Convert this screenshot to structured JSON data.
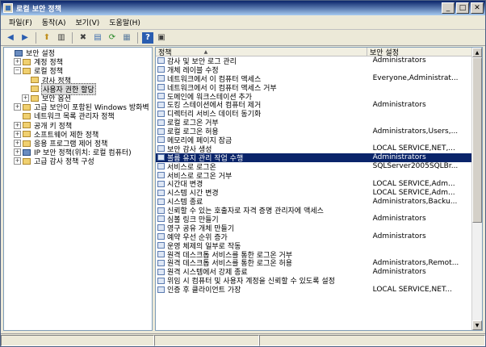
{
  "window": {
    "title": "로컬 보안 정책",
    "min_glyph": "_",
    "max_glyph": "□",
    "close_glyph": "✕"
  },
  "menu": [
    {
      "label": "파일(F)"
    },
    {
      "label": "동작(A)"
    },
    {
      "label": "보기(V)"
    },
    {
      "label": "도움말(H)"
    }
  ],
  "toolbar": [
    {
      "name": "back-icon",
      "glyph": "◀",
      "color": "#2a5db0"
    },
    {
      "name": "forward-icon",
      "glyph": "▶",
      "color": "#2a5db0"
    },
    {
      "sep": true
    },
    {
      "name": "up-folder-icon",
      "glyph": "⬆",
      "color": "#c09020"
    },
    {
      "name": "show-hide-tree-icon",
      "glyph": "▥",
      "color": "#404040"
    },
    {
      "sep": true
    },
    {
      "name": "delete-icon",
      "glyph": "✖",
      "color": "#404040"
    },
    {
      "name": "properties-icon",
      "glyph": "▤",
      "color": "#4070b0"
    },
    {
      "name": "refresh-icon",
      "glyph": "⟳",
      "color": "#2a8a2a"
    },
    {
      "name": "export-list-icon",
      "glyph": "▦",
      "color": "#6080a0"
    },
    {
      "sep": true
    },
    {
      "name": "help-icon",
      "glyph": "?",
      "color": "#ffffff",
      "bg": "#2a5db0"
    },
    {
      "name": "console-icon",
      "glyph": "▣",
      "color": "#404040"
    }
  ],
  "tree": [
    {
      "label": "보안 설정",
      "level": 0,
      "expander": "",
      "icon": "computer"
    },
    {
      "label": "계정 정책",
      "level": 1,
      "expander": "+",
      "icon": "folder"
    },
    {
      "label": "로컬 정책",
      "level": 1,
      "expander": "−",
      "icon": "folder"
    },
    {
      "label": "감사 정책",
      "level": 2,
      "expander": "",
      "icon": "folder"
    },
    {
      "label": "사용자 권한 할당",
      "level": 2,
      "expander": "",
      "icon": "folder",
      "selected": true
    },
    {
      "label": "보안 옵션",
      "level": 2,
      "expander": "+",
      "icon": "folder"
    },
    {
      "label": "고급 보안이 포함된 Windows 방화벽",
      "level": 1,
      "expander": "+",
      "icon": "folder"
    },
    {
      "label": "네트워크 목록 관리자 정책",
      "level": 1,
      "expander": "",
      "icon": "folder"
    },
    {
      "label": "공개 키 정책",
      "level": 1,
      "expander": "+",
      "icon": "folder"
    },
    {
      "label": "소프트웨어 제한 정책",
      "level": 1,
      "expander": "+",
      "icon": "folder"
    },
    {
      "label": "응용 프로그램 제어 정책",
      "level": 1,
      "expander": "+",
      "icon": "folder"
    },
    {
      "label": "IP 보안 정책(위치: 로컬 컴퓨터)",
      "level": 1,
      "expander": "+",
      "icon": "computer"
    },
    {
      "label": "고급 감사 정책 구성",
      "level": 1,
      "expander": "+",
      "icon": "folder"
    }
  ],
  "columns": {
    "policy": "정책",
    "setting": "보안 설정",
    "sort_glyph": "▲"
  },
  "policies": [
    {
      "name": "감사 및 보안 로그 관리",
      "setting": "Administrators"
    },
    {
      "name": "개체 레이블 수정",
      "setting": ""
    },
    {
      "name": "네트워크에서 이 컴퓨터 액세스",
      "setting": "Everyone,Administrat..."
    },
    {
      "name": "네트워크에서 이 컴퓨터 액세스 거부",
      "setting": ""
    },
    {
      "name": "도메인에 워크스테이션 추가",
      "setting": ""
    },
    {
      "name": "도킹 스테이션에서 컴퓨터 제거",
      "setting": "Administrators"
    },
    {
      "name": "디렉터리 서비스 데이터 동기화",
      "setting": ""
    },
    {
      "name": "로컬 로그온 거부",
      "setting": ""
    },
    {
      "name": "로컬 로그온 허용",
      "setting": "Administrators,Users,..."
    },
    {
      "name": "메모리에 페이지 잠금",
      "setting": ""
    },
    {
      "name": "보안 감사 생성",
      "setting": "LOCAL SERVICE,NET,..."
    },
    {
      "name": "볼륨 유지 관리 작업 수행",
      "setting": "Administrators",
      "selected": true
    },
    {
      "name": "서비스로 로그온",
      "setting": "SQLServer2005SQLBr..."
    },
    {
      "name": "서비스로 로그온 거부",
      "setting": ""
    },
    {
      "name": "시간대 변경",
      "setting": "LOCAL SERVICE,Adm..."
    },
    {
      "name": "시스템 시간 변경",
      "setting": "LOCAL SERVICE,Adm..."
    },
    {
      "name": "시스템 종료",
      "setting": "Administrators,Backu..."
    },
    {
      "name": "신뢰할 수 있는 호출자로 자격 증명 관리자에 액세스",
      "setting": ""
    },
    {
      "name": "심볼 링크 만들기",
      "setting": "Administrators"
    },
    {
      "name": "영구 공유 개체 만들기",
      "setting": ""
    },
    {
      "name": "예약 우선 순위 증가",
      "setting": "Administrators"
    },
    {
      "name": "운영 체제의 일부로 작동",
      "setting": ""
    },
    {
      "name": "원격 데스크톱 서비스를 통한 로그온 거부",
      "setting": ""
    },
    {
      "name": "원격 데스크톱 서비스를 통한 로그온 허용",
      "setting": "Administrators,Remot..."
    },
    {
      "name": "원격 시스템에서 강제 종료",
      "setting": "Administrators"
    },
    {
      "name": "위임 시 컴퓨터 및 사용자 계정을 신뢰할 수 있도록 설정",
      "setting": ""
    },
    {
      "name": "인증 후 클라이언트 가장",
      "setting": "LOCAL SERVICE,NET..."
    }
  ],
  "scroll": {
    "up_glyph": "▲",
    "down_glyph": "▼"
  }
}
